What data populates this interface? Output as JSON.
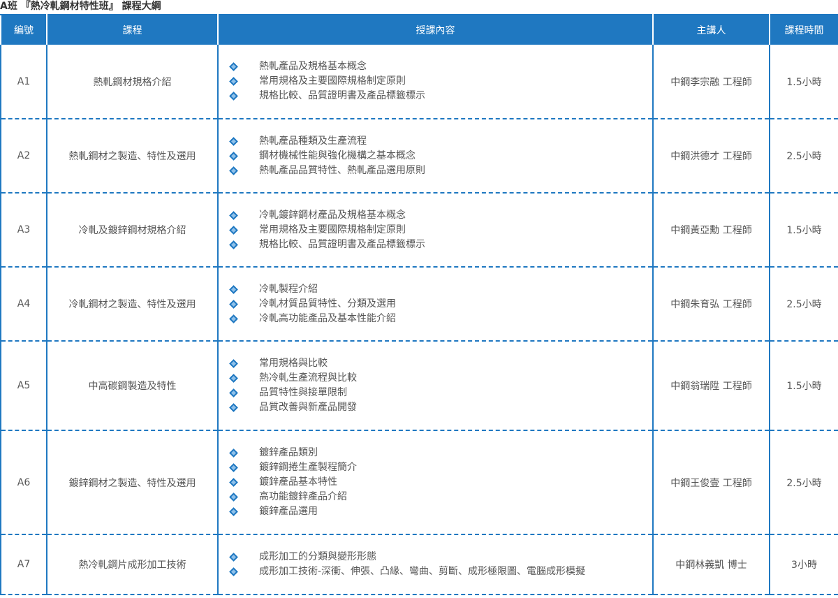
{
  "title": "A班 『熱冷軋鋼材特性班』 課程大綱",
  "headers": {
    "id": "編號",
    "course": "課程",
    "content": "授課內容",
    "lecturer": "主講人",
    "hours": "課程時間"
  },
  "rows": [
    {
      "id": "A1",
      "course": "熱軋鋼材規格介紹",
      "items": [
        "熱軋產品及規格基本概念",
        "常用規格及主要國際規格制定原則",
        "規格比較、品質證明書及產品標籤標示"
      ],
      "lecturer": "中鋼李宗融 工程師",
      "hours": "1.5小時"
    },
    {
      "id": "A2",
      "course": "熱軋鋼材之製造、特性及選用",
      "items": [
        "熱軋產品種類及生產流程",
        "鋼材機械性能與強化機構之基本概念",
        "熱軋產品品質特性、熱軋產品選用原則"
      ],
      "lecturer": "中鋼洪德才 工程師",
      "hours": "2.5小時"
    },
    {
      "id": "A3",
      "course": "冷軋及鍍鋅鋼材規格介紹",
      "items": [
        "冷軋鍍鋅鋼材產品及規格基本概念",
        "常用規格及主要國際規格制定原則",
        "規格比較、品質證明書及產品標籤標示"
      ],
      "lecturer": "中鋼黃亞勳 工程師",
      "hours": "1.5小時"
    },
    {
      "id": "A4",
      "course": "冷軋鋼材之製造、特性及選用",
      "items": [
        "冷軋製程介紹",
        "冷軋材質品質特性、分類及選用",
        "冷軋高功能產品及基本性能介紹"
      ],
      "lecturer": "中鋼朱育弘 工程師",
      "hours": "2.5小時"
    },
    {
      "id": "A5",
      "course": "中高碳鋼製造及特性",
      "items": [
        "常用規格與比較",
        "熱冷軋生產流程與比較",
        "品質特性與接單限制",
        "品質改善與新產品開發"
      ],
      "lecturer": "中鋼翁瑞陞 工程師",
      "hours": "1.5小時"
    },
    {
      "id": "A6",
      "course": "鍍鋅鋼材之製造、特性及選用",
      "items": [
        "鍍鋅產品類別",
        "鍍鋅鋼捲生產製程簡介",
        "鍍鋅產品基本特性",
        "高功能鍍鋅產品介紹",
        "鍍鋅產品選用"
      ],
      "lecturer": "中鋼王俊壹 工程師",
      "hours": "2.5小時"
    },
    {
      "id": "A7",
      "course": "熱冷軋鋼片成形加工技術",
      "items": [
        "成形加工的分類與變形形態",
        "成形加工技術-深衝、伸張、凸緣、彎曲、剪斷、成形極限圖、電腦成形模擬"
      ],
      "lecturer": "中鋼林義凱 博士",
      "hours": "3小時"
    }
  ]
}
